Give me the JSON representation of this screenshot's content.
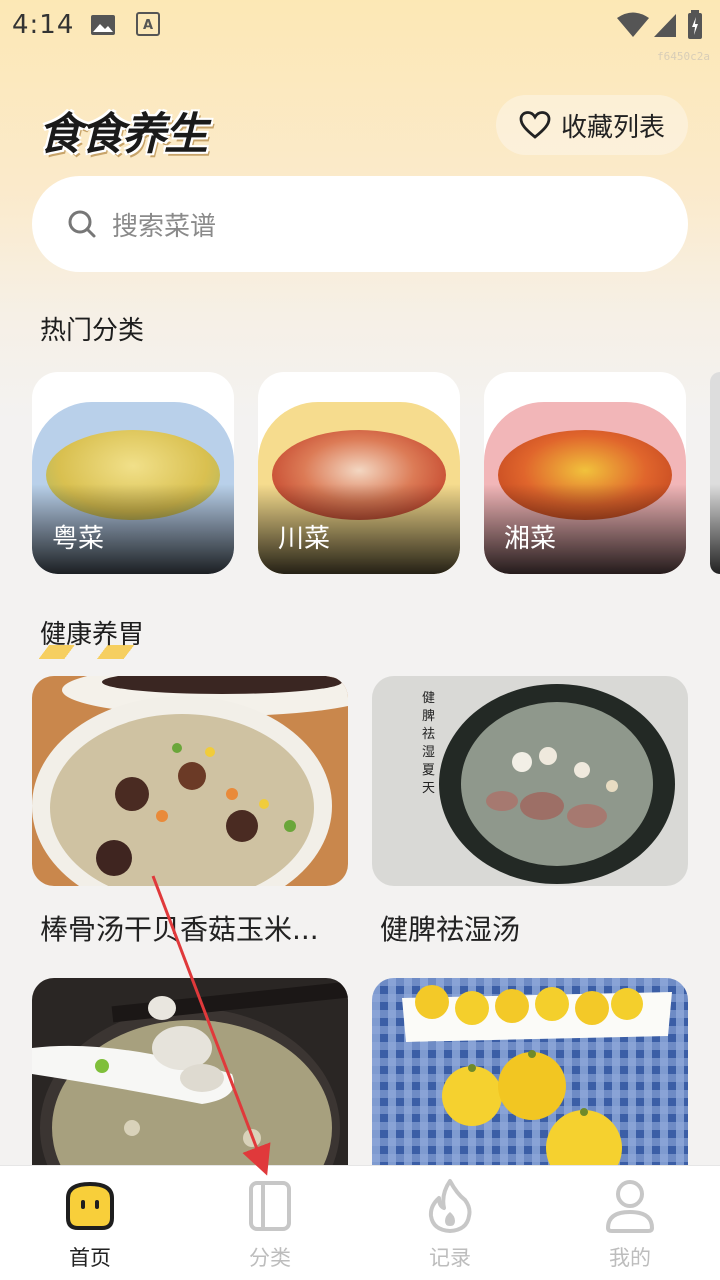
{
  "status_bar": {
    "time": "4:14",
    "watermark": "f6450c2a",
    "icons": [
      "image-icon",
      "font-a-icon",
      "wifi-icon",
      "signal-icon",
      "battery-charging-icon"
    ]
  },
  "header": {
    "logo_text": "食食养生",
    "favorites_label": "收藏列表"
  },
  "search": {
    "placeholder": "搜索菜谱"
  },
  "hot_categories": {
    "title": "热门分类",
    "items": [
      {
        "label": "粤菜",
        "plate_color": "#b9d0ea",
        "dish_color": "#e9d36a"
      },
      {
        "label": "川菜",
        "plate_color": "#f6dc8e",
        "dish_color": "#c84a2c"
      },
      {
        "label": "湘菜",
        "plate_color": "#f2b6b8",
        "dish_color": "#d8612e"
      }
    ]
  },
  "healthy_stomach": {
    "title": "健康养胃",
    "recipes": [
      {
        "title": "棒骨汤干贝香菇玉米...",
        "photo": "soup-with-mushroom-corn"
      },
      {
        "title": "健脾祛湿汤",
        "photo": "dark-bowl-meat-soup",
        "photo_caption": "健脾祛湿夏天"
      },
      {
        "title": "",
        "photo": "fish-soup-spoon"
      },
      {
        "title": "",
        "photo": "yellow-pumpkin-buns"
      }
    ]
  },
  "bottom_nav": {
    "items": [
      {
        "label": "首页",
        "icon": "home-face-icon",
        "active": true
      },
      {
        "label": "分类",
        "icon": "book-icon",
        "active": false
      },
      {
        "label": "记录",
        "icon": "flame-icon",
        "active": false
      },
      {
        "label": "我的",
        "icon": "user-icon",
        "active": false
      }
    ]
  },
  "colors": {
    "accent_yellow": "#f7c947",
    "nav_inactive": "#bdbdbd",
    "annotation_red": "#e0393b"
  }
}
